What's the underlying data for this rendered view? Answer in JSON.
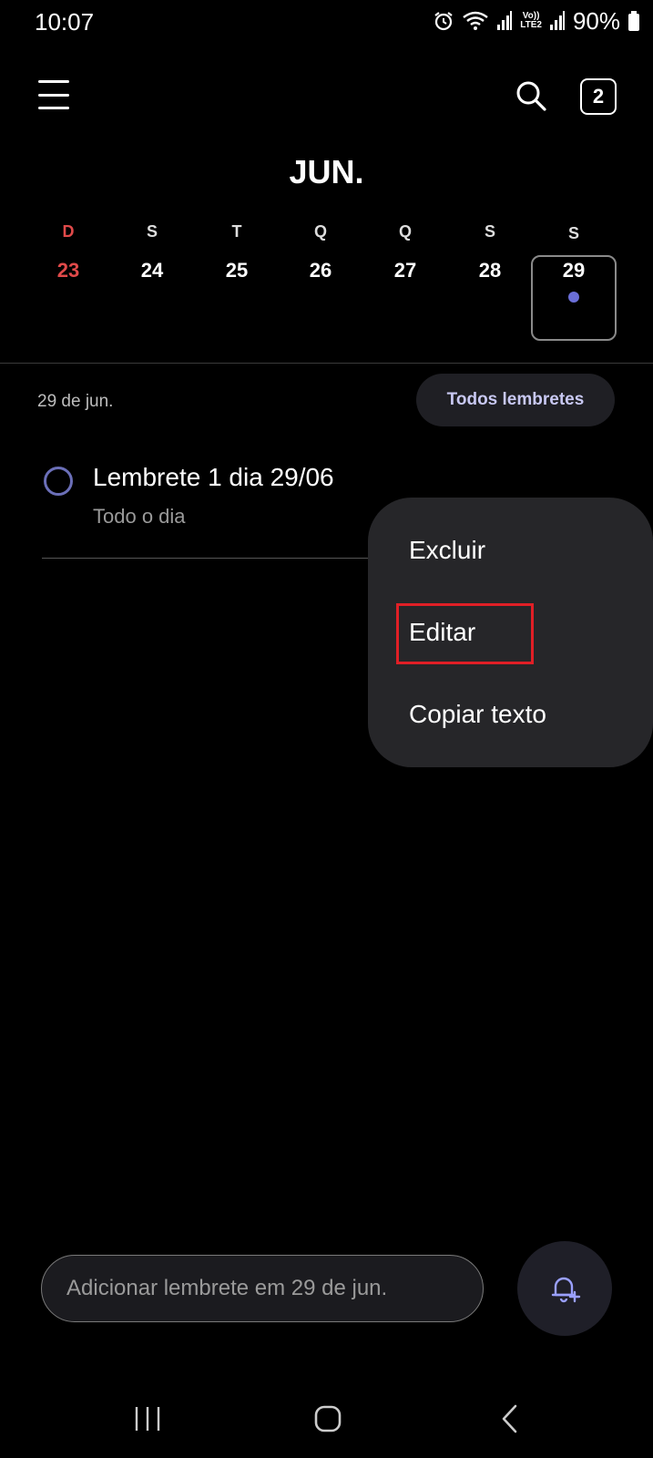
{
  "status_bar": {
    "time": "10:07",
    "lte_top": "Vo))",
    "lte_bottom": "LTE2",
    "battery": "90%",
    "icons": [
      "alarm-icon",
      "wifi-icon",
      "signal-icon",
      "battery-icon"
    ]
  },
  "header": {
    "menu_icon": "hamburger-menu-icon",
    "search_icon": "search-icon",
    "reminder_count": "2",
    "month": "JUN."
  },
  "week": [
    {
      "letter": "D",
      "number": "23",
      "sunday": true,
      "selected": false
    },
    {
      "letter": "S",
      "number": "24",
      "sunday": false,
      "selected": false
    },
    {
      "letter": "T",
      "number": "25",
      "sunday": false,
      "selected": false
    },
    {
      "letter": "Q",
      "number": "26",
      "sunday": false,
      "selected": false
    },
    {
      "letter": "Q",
      "number": "27",
      "sunday": false,
      "selected": false
    },
    {
      "letter": "S",
      "number": "28",
      "sunday": false,
      "selected": false
    },
    {
      "letter": "S",
      "number": "29",
      "sunday": false,
      "selected": true,
      "has_event": true
    }
  ],
  "list_header": {
    "date_label": "29 de jun.",
    "filter_button": "Todos lembretes"
  },
  "reminders": [
    {
      "title": "Lembrete 1 dia 29/06",
      "subtitle": "Todo o dia"
    }
  ],
  "context_menu": {
    "items": [
      "Excluir",
      "Editar",
      "Copiar texto"
    ],
    "highlighted": "Editar"
  },
  "bottom": {
    "input_placeholder": "Adicionar lembrete em 29 de jun.",
    "add_icon": "bell-plus-icon"
  },
  "nav": {
    "icons": [
      "recent-apps-icon",
      "home-icon",
      "back-icon"
    ]
  },
  "colors": {
    "background": "#000000",
    "sunday": "#e04a4a",
    "accent": "#6b6fd8",
    "highlight": "#e01f26",
    "menu_bg": "#262629"
  }
}
